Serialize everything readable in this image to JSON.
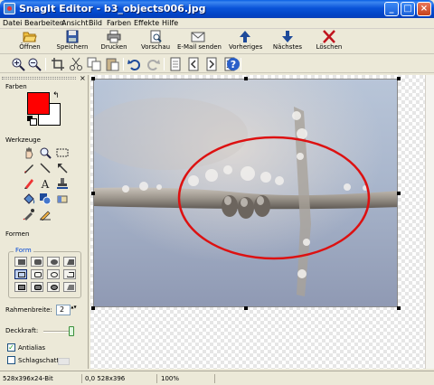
{
  "window": {
    "title": "SnagIt Editor - b3_objects006.jpg",
    "minimize": "_",
    "maximize": "□",
    "close": "×"
  },
  "menu": [
    "Datei",
    "Bearbeiten",
    "Ansicht",
    "Bild",
    "Farben",
    "Effekte",
    "Hilfe"
  ],
  "toolbar": {
    "open": "Öffnen",
    "save": "Speichern",
    "print": "Drucken",
    "preview": "Vorschau",
    "email": "E-Mail senden",
    "previous": "Vorheriges",
    "next": "Nächstes",
    "delete": "Löschen"
  },
  "panel": {
    "close_glyph": "×",
    "colors_label": "Farben",
    "foreground_color": "#ff0000",
    "background_color": "#ffffff",
    "tools_label": "Werkzeuge",
    "shapes_label": "Formen",
    "form_label": "Form",
    "border_width_label": "Rahmenbreite:",
    "border_width_value": "2",
    "opacity_label": "Deckkraft:",
    "opacity_fraction": 1.0,
    "antialias_label": "Antialias",
    "antialias_checked": true,
    "shadow_label": "Schlagschatten",
    "shadow_checked": false,
    "check_glyph": "✓",
    "swap_glyph": "↰",
    "spin_glyph": "▲▼"
  },
  "status": {
    "image_info": "528x396x24-Bit",
    "position": "0,0  528x396",
    "zoom": "100%"
  },
  "accent_color": "#0054e3",
  "annotation_color": "#dd1111"
}
